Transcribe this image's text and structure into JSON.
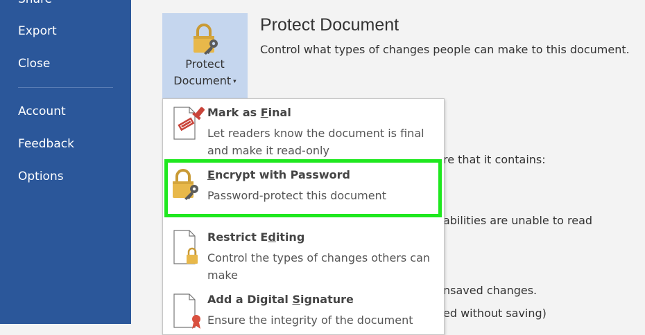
{
  "sidebar": {
    "items": [
      {
        "label": "Share"
      },
      {
        "label": "Export"
      },
      {
        "label": "Close"
      },
      {
        "label": "Account"
      },
      {
        "label": "Feedback"
      },
      {
        "label": "Options"
      }
    ],
    "bg_color": "#2b579a"
  },
  "protect_button": {
    "line1": "Protect",
    "line2": "Document",
    "caret": "▾",
    "icon": "lock-key-icon"
  },
  "section": {
    "title": "Protect Document",
    "description": "Control what types of changes people can make to this document."
  },
  "background_text": {
    "line1": "re that it contains:",
    "line2": "abilities are unable to read",
    "line3": "nsaved changes.",
    "line4": "ed without saving)"
  },
  "menu": {
    "items": [
      {
        "title_pre": "Mark as ",
        "title_accel": "F",
        "title_post": "inal",
        "desc": "Let readers know the document is final and make it read-only",
        "icon": "mark-final-icon"
      },
      {
        "title_pre": "",
        "title_accel": "E",
        "title_post": "ncrypt with Password",
        "desc": "Password-protect this document",
        "icon": "lock-key-icon"
      },
      {
        "title_pre": "Restrict E",
        "title_accel": "d",
        "title_post": "iting",
        "desc": "Control the types of changes others can make",
        "icon": "restrict-editing-icon"
      },
      {
        "title_pre": "Add a Digital ",
        "title_accel": "S",
        "title_post": "ignature",
        "desc": "Ensure the integrity of the document",
        "icon": "digital-signature-icon"
      }
    ]
  },
  "colors": {
    "highlight": "#1fe81f",
    "button_bg": "#c5d6ee",
    "lock_gold": "#e8b84a"
  }
}
